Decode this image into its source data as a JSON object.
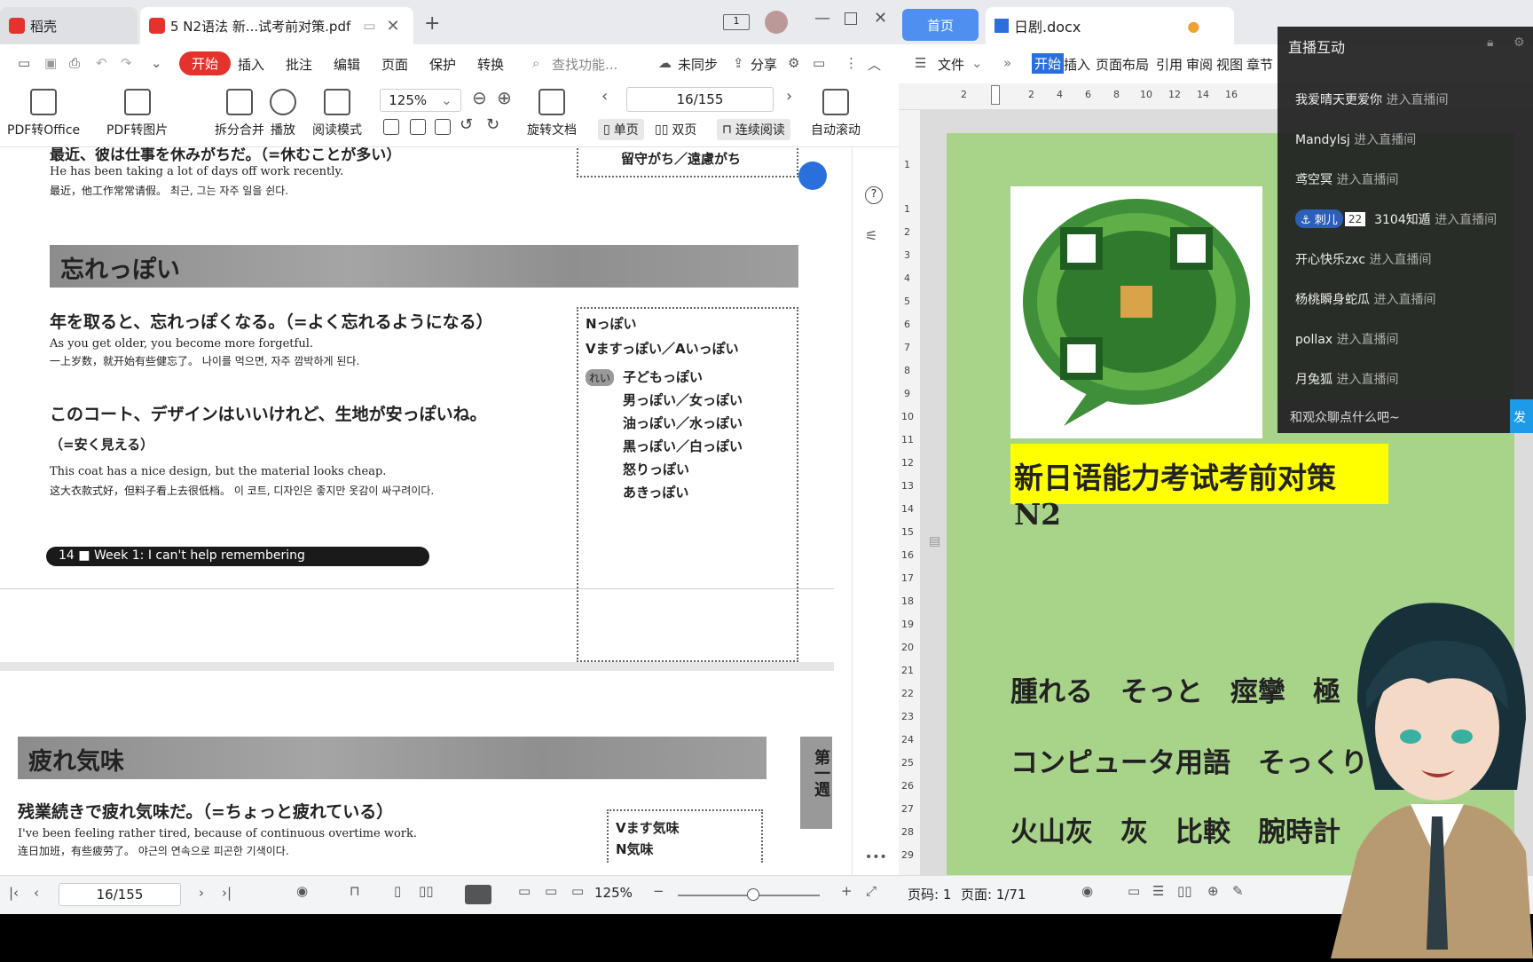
{
  "left": {
    "tabs": {
      "home": "稻壳",
      "pdf": "5 N2语法  新...试考前对策.pdf"
    },
    "menu": [
      "开始",
      "插入",
      "批注",
      "编辑",
      "页面",
      "保护",
      "转换"
    ],
    "search": "查找功能...",
    "sync": "未同步",
    "share": "分享",
    "ribbon": {
      "pdf_to_office": "PDF转Office",
      "pdf_to_image": "PDF转图片",
      "split_merge": "拆分合并",
      "play": "播放",
      "read_mode": "阅读模式",
      "zoom": "125%",
      "rotate": "旋转文档",
      "page": "16/155",
      "single": "单页",
      "double": "双页",
      "continuous": "连续阅读",
      "autoscroll": "自动滚动"
    },
    "content": {
      "line1": "最近、彼は仕事を休みがちだ。（=休むことが多い）",
      "line1_en": "He has been taking a lot of days off work recently.",
      "line1_zh": "最近，他工作常常请假。  최근, 그는 자주 일을 쉰다.",
      "box_top": "留守がち／遠慮がち",
      "head1": "忘れっぽい",
      "ex1": "年を取ると、忘れっぽくなる。（=よく忘れるようになる）",
      "ex1_en": "As you get older, you become more forgetful.",
      "ex1_zh": "一上岁数，就开始有些健忘了。  나이를 먹으면, 자주 깜박하게 된다.",
      "ex2": "このコート、デザインはいいけれど、生地が安っぽいね。",
      "ex2b": "（=安く見える）",
      "ex2_en": "This coat has a nice design, but the material looks cheap.",
      "ex2_zh": "这大衣款式好，但料子看上去很低档。  이 코트, 디자인은 좋지만 옷감이 싸구려이다.",
      "box_lines": [
        "Nっぽい",
        "Vますっぽい／Aいっぽい"
      ],
      "rei": "れい",
      "rei_lines": [
        "子どもっぽい",
        "男っぽい／女っぽい",
        "油っぽい／水っぽい",
        "黒っぽい／白っぽい",
        "怒りっぽい",
        "あきっぽい"
      ],
      "week_label": "14 ■ Week 1: I can't help remembering",
      "head2": "疲れ気味",
      "ex3": "残業続きで疲れ気味だ。（=ちょっと疲れている）",
      "ex3_en": "I've been feeling rather tired, because of continuous overtime work.",
      "ex3_zh": "连日加班，有些疲劳了。  야근의 연속으로 피곤한 기색이다.",
      "box2": [
        "Vます気味",
        "N気味"
      ],
      "side_tab": "第一週"
    },
    "bottom": {
      "page": "16/155",
      "zoom": "125%"
    }
  },
  "right": {
    "tabs": {
      "home": "首页",
      "doc": "日剧.docx"
    },
    "menu": [
      "文件",
      "开始",
      "插入",
      "页面布局",
      "引用",
      "审阅",
      "视图",
      "章节"
    ],
    "ruler": [
      "2",
      "2",
      "4",
      "6",
      "8",
      "10",
      "12",
      "14",
      "16"
    ],
    "vruler": [
      "1",
      "1",
      "2",
      "3",
      "4",
      "5",
      "6",
      "7",
      "8",
      "9",
      "10",
      "11",
      "12",
      "13",
      "14",
      "15",
      "16",
      "17",
      "18",
      "19",
      "20",
      "21",
      "22",
      "23",
      "24",
      "25",
      "26",
      "27",
      "28",
      "29"
    ],
    "title": "新日语能力考试考前对策 N2",
    "words": [
      "腫れる　そっと　痙攣　極",
      "コンピュータ用語　そっくり",
      "火山灰　灰　比較　腕時計"
    ],
    "status": {
      "page_no": "页码: 1",
      "pages": "页面: 1/71"
    }
  },
  "live": {
    "title": "直播互动",
    "enter_suffix": "进入直播间",
    "badge_name": "刺儿",
    "badge_level": "22",
    "users": [
      "我爱晴天更爱你",
      "Mandylsj",
      "鸢空冥",
      "3104知遁",
      "开心快乐zxc",
      "杨桃瞬身蛇瓜",
      "pollax",
      "月兔狐"
    ],
    "chat_placeholder": "和观众聊点什么吧~",
    "send": "发"
  },
  "colors": {
    "accent": "#e5322d",
    "wps_blue": "#2a6fdb",
    "doc_green": "#a8d48a",
    "title_yellow": "#ffff00"
  }
}
